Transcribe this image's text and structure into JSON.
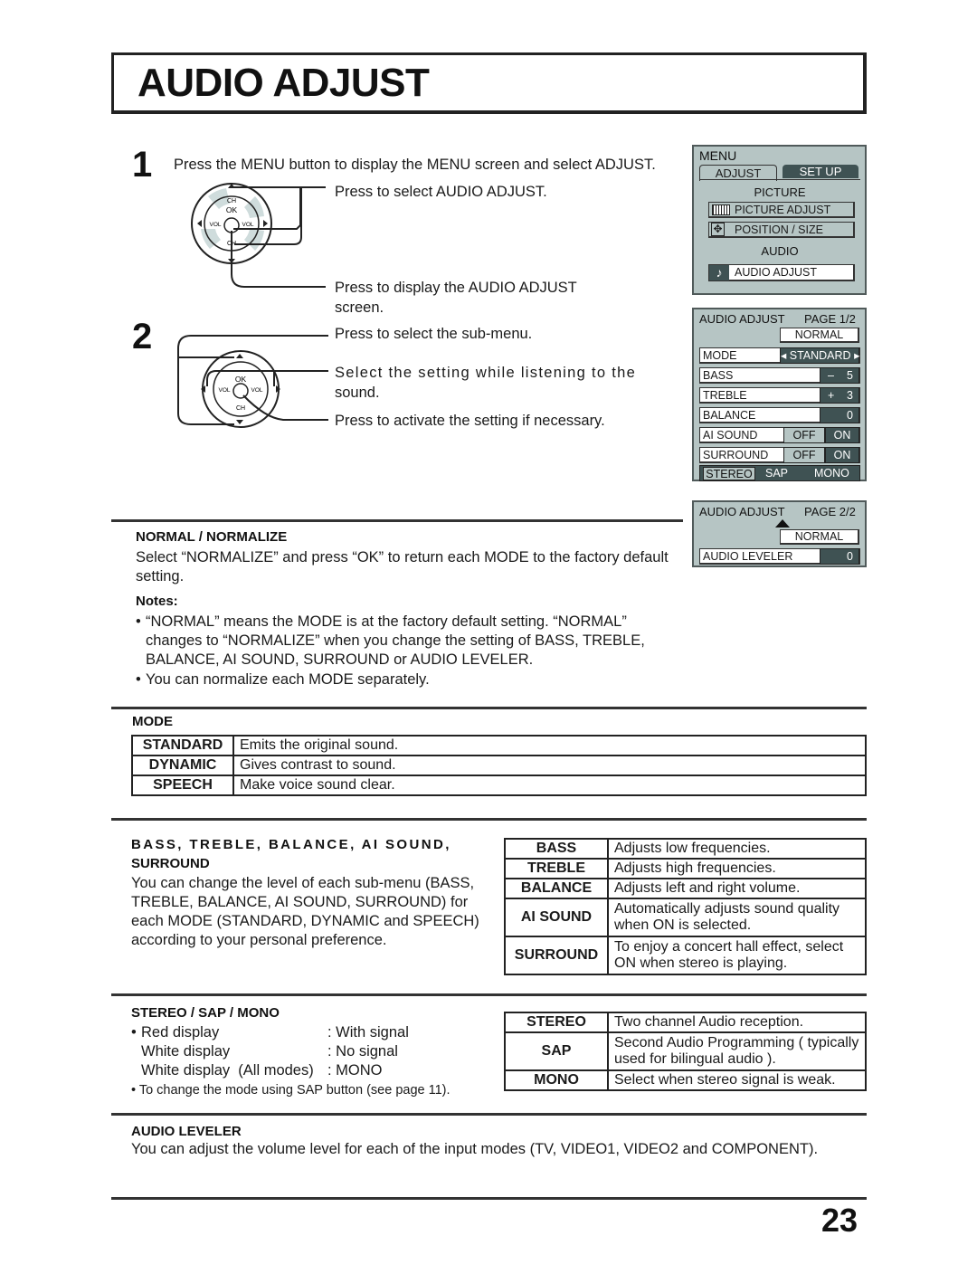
{
  "page": {
    "title": "AUDIO ADJUST",
    "page_number": "23"
  },
  "steps": [
    {
      "number": "1",
      "intro": "Press the MENU button to display the MENU screen and select ADJUST.",
      "callouts": [
        "Press to select AUDIO ADJUST.",
        "Press to display the AUDIO ADJUST",
        "screen."
      ]
    },
    {
      "number": "2",
      "callouts": [
        "Press to select the sub-menu.",
        "Select the setting while listening to the",
        "sound.",
        "Press to activate the setting if necessary."
      ]
    }
  ],
  "remote_pad": {
    "labels": {
      "ch": "CH",
      "ok": "OK",
      "vol": "VOL"
    }
  },
  "osd_menu": {
    "title": "MENU",
    "tabs": [
      "ADJUST",
      "SET UP"
    ],
    "section_picture": "PICTURE",
    "items": [
      {
        "icon": "picture-adjust-icon",
        "label": "PICTURE  ADJUST"
      },
      {
        "icon": "position-size-icon",
        "label": "POSITION / SIZE"
      }
    ],
    "section_audio": "AUDIO",
    "audio_item": {
      "icon": "music-note-icon",
      "label": "AUDIO  ADJUST"
    }
  },
  "osd_audio_p1": {
    "title": "AUDIO  ADJUST",
    "page": "PAGE 1/2",
    "normal": "NORMAL",
    "rows": [
      {
        "label": "MODE",
        "value": "STANDARD"
      },
      {
        "label": "BASS",
        "sign": "–",
        "value": "5"
      },
      {
        "label": "TREBLE",
        "sign": "+",
        "value": "3"
      },
      {
        "label": "BALANCE",
        "sign": "",
        "value": "0"
      },
      {
        "label": "AI SOUND",
        "off": "OFF",
        "on": "ON"
      },
      {
        "label": "SURROUND",
        "off": "OFF",
        "on": "ON"
      }
    ],
    "sound_modes": [
      "STEREO",
      "SAP",
      "MONO"
    ]
  },
  "osd_audio_p2": {
    "title": "AUDIO  ADJUST",
    "page": "PAGE 2/2",
    "normal": "NORMAL",
    "row": {
      "label": "AUDIO LEVELER",
      "value": "0"
    }
  },
  "normalize": {
    "heading": "NORMAL / NORMALIZE",
    "body": "Select “NORMALIZE” and press “OK” to return each MODE to the factory default setting.",
    "notes_heading": "Notes:",
    "notes": [
      "“NORMAL” means the MODE is at the factory default setting. “NORMAL” changes to “NORMALIZE” when you change the setting of BASS, TREBLE, BALANCE, AI SOUND, SURROUND or AUDIO LEVELER.",
      "You can normalize each MODE separately."
    ]
  },
  "mode": {
    "heading": "MODE",
    "rows": [
      {
        "key": "STANDARD",
        "desc": "Emits the original sound."
      },
      {
        "key": "DYNAMIC",
        "desc": "Gives contrast to sound."
      },
      {
        "key": "SPEECH",
        "desc": "Make voice sound clear."
      }
    ]
  },
  "levels": {
    "heading_line1": "BASS, TREBLE, BALANCE, AI SOUND,",
    "heading_line2": "SURROUND",
    "body": "You can change the level of each sub-menu (BASS, TREBLE, BALANCE, AI SOUND, SURROUND) for each MODE (STANDARD, DYNAMIC and SPEECH) according to your personal preference.",
    "rows": [
      {
        "key": "BASS",
        "desc": "Adjusts low frequencies."
      },
      {
        "key": "TREBLE",
        "desc": "Adjusts high frequencies."
      },
      {
        "key": "BALANCE",
        "desc": "Adjusts left and right volume."
      },
      {
        "key": "AI SOUND",
        "desc": "Automatically adjusts sound quality when ON is selected."
      },
      {
        "key": "SURROUND",
        "desc": "To enjoy a concert hall effect, select ON when stereo is playing."
      }
    ]
  },
  "stereo": {
    "heading": "STEREO / SAP / MONO",
    "display_rows": [
      {
        "label": "Red display",
        "value": ": With signal"
      },
      {
        "label": "White display",
        "value": ": No signal"
      },
      {
        "label": "White display  (All modes)",
        "value": ": MONO"
      }
    ],
    "note": "To change the mode using SAP button (see page 11).",
    "rows": [
      {
        "key": "STEREO",
        "desc": "Two channel Audio reception."
      },
      {
        "key": "SAP",
        "desc": "Second Audio Programming ( typically used for bilingual audio )."
      },
      {
        "key": "MONO",
        "desc": "Select when stereo signal is weak."
      }
    ]
  },
  "leveler": {
    "heading": "AUDIO LEVELER",
    "body": "You can adjust the volume level for each of the input modes (TV, VIDEO1, VIDEO2 and COMPONENT)."
  }
}
